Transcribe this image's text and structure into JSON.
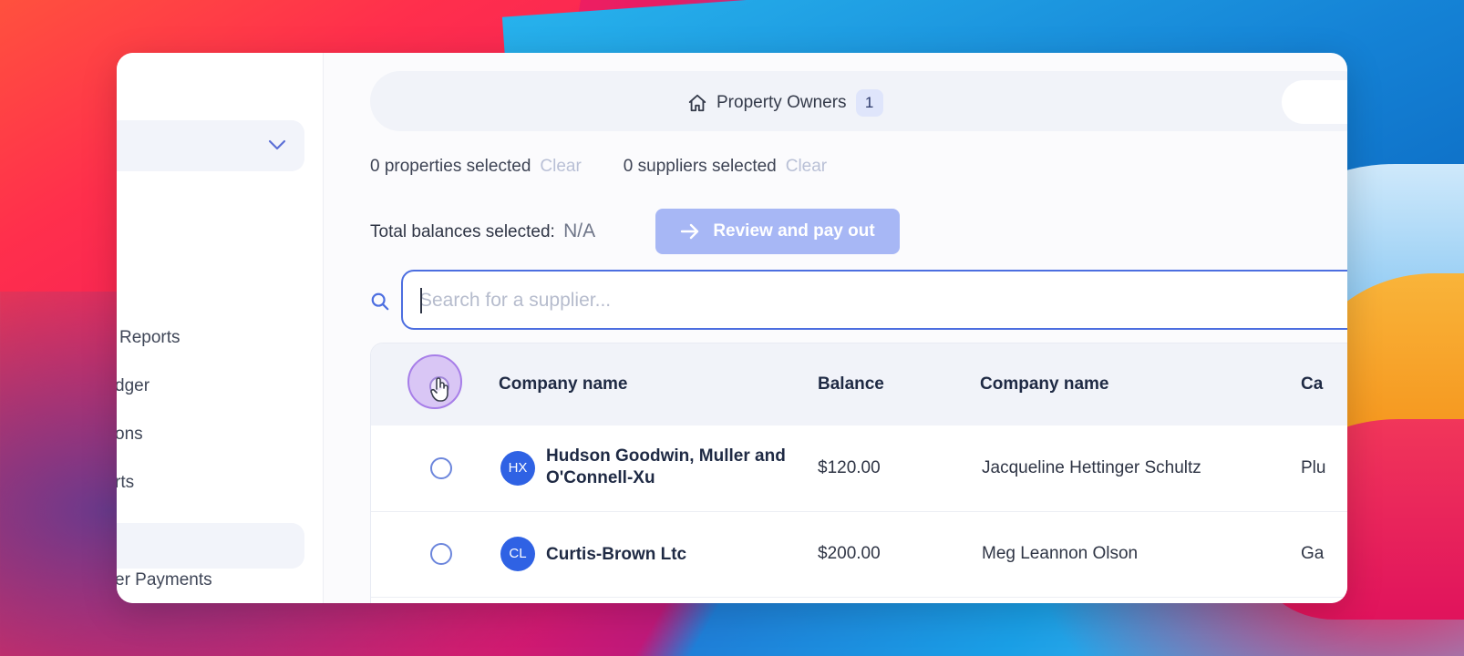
{
  "sidebar": {
    "items": [
      {
        "label": "Reports"
      },
      {
        "label": "dger"
      },
      {
        "label": "ons"
      },
      {
        "label": "rts"
      },
      {
        "label": "er Payments"
      }
    ]
  },
  "tabs": [
    {
      "label": "Property Owners",
      "count": "1"
    }
  ],
  "selection": {
    "properties": "0 properties selected",
    "suppliers": "0 suppliers selected",
    "clear_label": "Clear"
  },
  "total": {
    "label": "Total balances selected:",
    "value": "N/A"
  },
  "pay_button": {
    "label": "Review and pay out"
  },
  "search": {
    "placeholder": "Search for a supplier..."
  },
  "table": {
    "headers": [
      "Company name",
      "Balance",
      "Company name",
      "Ca"
    ],
    "rows": [
      {
        "initials": "HX",
        "company": "Hudson Goodwin, Muller and O'Connell-Xu",
        "balance": "$120.00",
        "contact": "Jacqueline Hettinger Schultz",
        "category": "Plu"
      },
      {
        "initials": "CL",
        "company": "Curtis-Brown Ltc",
        "balance": "$200.00",
        "contact": "Meg Leannon Olson",
        "category": "Ga"
      }
    ]
  },
  "colors": {
    "accent": "#4c6ee0",
    "avatar": "#2f62e4",
    "pay_button_disabled": "#a7b7f5"
  }
}
